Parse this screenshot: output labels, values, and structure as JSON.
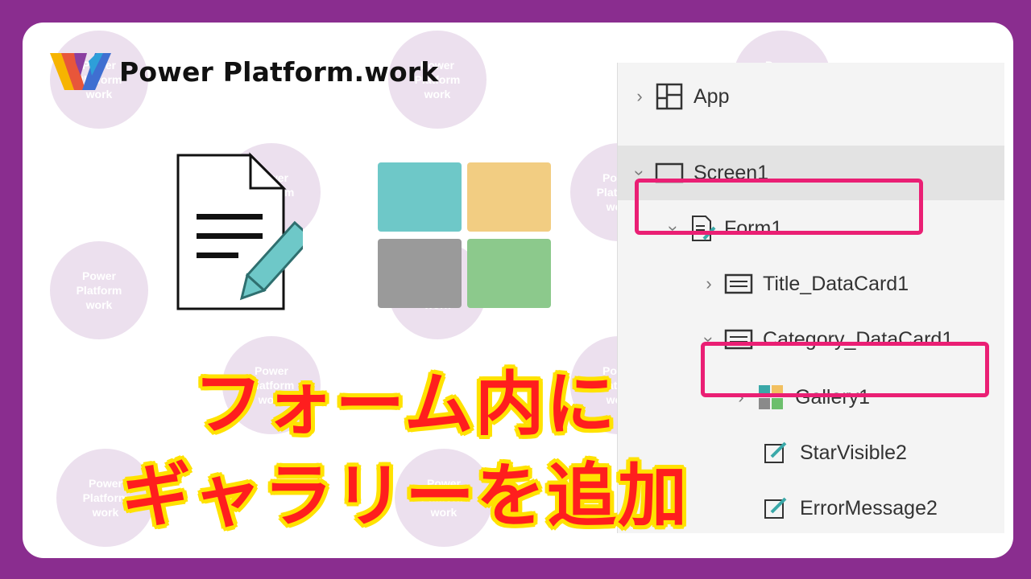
{
  "brand": {
    "logo_text": "Power Platform.work",
    "watermark_text": "Power\nPlatform\nwork"
  },
  "headline": {
    "line1": "フォーム内に",
    "line2": "ギャラリーを追加"
  },
  "tree_view": {
    "items": [
      {
        "label": "App",
        "icon": "app-icon",
        "expanded": false
      },
      {
        "label": "Screen1",
        "icon": "screen-icon",
        "expanded": true,
        "selected": true
      },
      {
        "label": "Form1",
        "icon": "form-icon",
        "expanded": true,
        "highlighted": true
      },
      {
        "label": "Title_DataCard1",
        "icon": "datacard-icon",
        "expanded": false
      },
      {
        "label": "Category_DataCard1",
        "icon": "datacard-icon",
        "expanded": true
      },
      {
        "label": "Gallery1",
        "icon": "gallery-icon",
        "expanded": false,
        "highlighted": true
      },
      {
        "label": "StarVisible2",
        "icon": "edit-icon"
      },
      {
        "label": "ErrorMessage2",
        "icon": "edit-icon"
      }
    ]
  },
  "colors": {
    "frame": "#8a2d8f",
    "highlight": "#ea1f74",
    "headline_fill": "#ff1e1e",
    "headline_stroke": "#ffe200",
    "gallery_tiles": [
      "#6ec8c8",
      "#f2cd82",
      "#9a9a9a",
      "#8cc98c"
    ]
  }
}
